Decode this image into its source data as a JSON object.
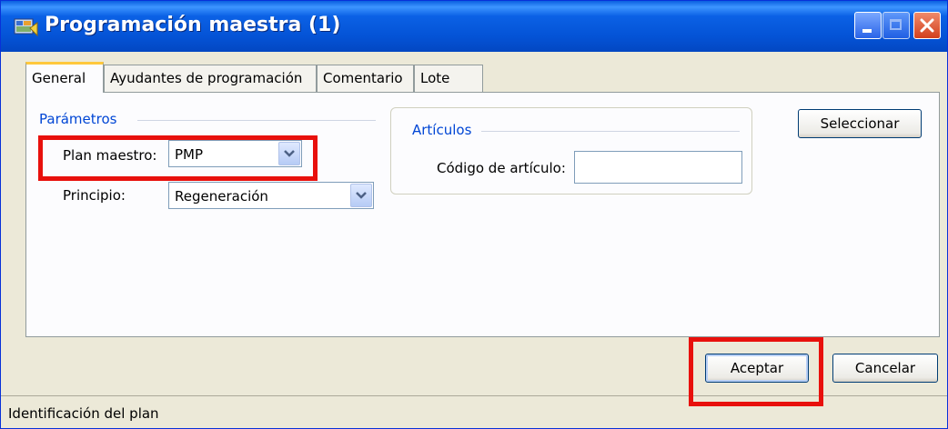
{
  "window": {
    "title": "Programación maestra (1)"
  },
  "tabs": [
    {
      "label": "General"
    },
    {
      "label": "Ayudantes de programación"
    },
    {
      "label": "Comentario"
    },
    {
      "label": "Lote"
    }
  ],
  "parametros": {
    "group_label": "Parámetros",
    "plan_maestro_label": "Plan maestro:",
    "plan_maestro_value": "PMP",
    "principio_label": "Principio:",
    "principio_value": "Regeneración"
  },
  "articulos": {
    "group_label": "Artículos",
    "codigo_label": "Código de artículo:",
    "codigo_value": ""
  },
  "buttons": {
    "seleccionar": "Seleccionar",
    "aceptar": "Aceptar",
    "cancelar": "Cancelar"
  },
  "status": {
    "text": "Identificación del plan"
  },
  "colors": {
    "titlebar": "#0453d6",
    "highlight": "#e8100c",
    "group_label": "#0046d5"
  }
}
